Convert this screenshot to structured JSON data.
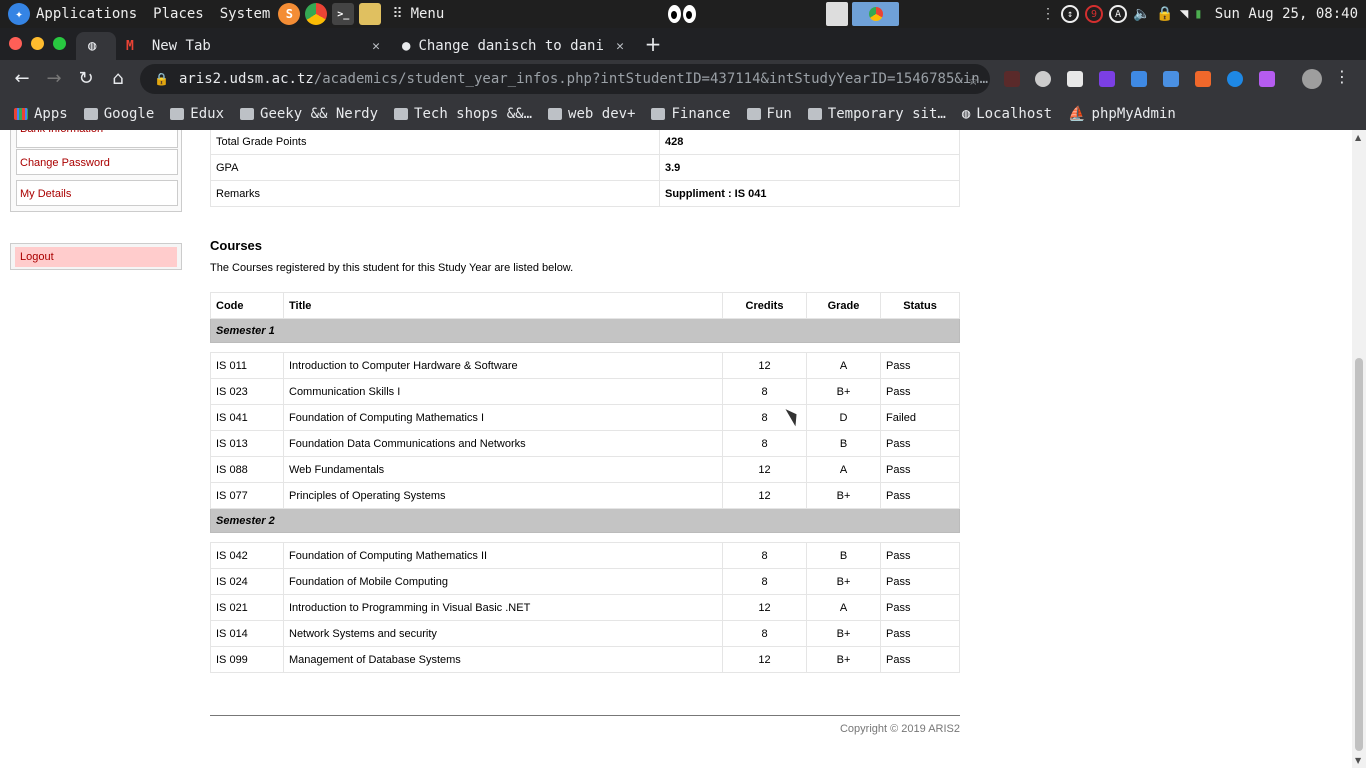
{
  "panel": {
    "menus": [
      "Applications",
      "Places",
      "System"
    ],
    "menu_label": "Menu",
    "launchers": [
      {
        "icon": "sublime-icon",
        "glyph": "S",
        "color": "#f48d35"
      },
      {
        "icon": "chrome-icon",
        "glyph": "",
        "color": "#4caf50"
      },
      {
        "icon": "terminal-icon",
        "glyph": ">_",
        "color": "#444444"
      },
      {
        "icon": "files-icon",
        "glyph": "",
        "color": "#e0c060"
      }
    ],
    "tray": {
      "notification_count": "9",
      "clock": "Sun Aug 25, 08:40"
    }
  },
  "browser": {
    "tabs": [
      {
        "title": "",
        "icon": "globe-icon",
        "active": true
      },
      {
        "title": "New Tab",
        "icon": "gmail-icon",
        "active": false
      },
      {
        "title": "Change danisch to dani",
        "icon": "github-icon",
        "active": false
      }
    ],
    "new_tab_label": "+",
    "url_host": "aris2.udsm.ac.tz",
    "url_path": "/academics/student_year_infos.php?intStudentID=437114&intStudyYearID=1546785&in…",
    "bookmarks": [
      {
        "label": "Apps",
        "icon": "apps-icon"
      },
      {
        "label": "Google",
        "icon": "folder-icon"
      },
      {
        "label": "Edux",
        "icon": "folder-icon"
      },
      {
        "label": "Geeky && Nerdy",
        "icon": "folder-icon"
      },
      {
        "label": "Tech shops &&…",
        "icon": "folder-icon"
      },
      {
        "label": "web dev+",
        "icon": "folder-icon"
      },
      {
        "label": "Finance",
        "icon": "folder-icon"
      },
      {
        "label": "Fun",
        "icon": "folder-icon"
      },
      {
        "label": "Temporary sit…",
        "icon": "folder-icon"
      },
      {
        "label": "Localhost",
        "icon": "globe-icon"
      },
      {
        "label": "phpMyAdmin",
        "icon": "phpmyadmin-icon"
      }
    ]
  },
  "sidebar": {
    "partial_link": "Bank Information",
    "links": [
      "Change Password",
      "My Details"
    ],
    "logout": "Logout"
  },
  "summary": [
    {
      "label": "Total Grade Points",
      "value": "428"
    },
    {
      "label": "GPA",
      "value": "3.9"
    },
    {
      "label": "Remarks",
      "value": "Suppliment : IS 041"
    }
  ],
  "courses": {
    "heading": "Courses",
    "intro": "The Courses registered by this student for this Study Year are listed below.",
    "columns": [
      "Code",
      "Title",
      "Credits",
      "Grade",
      "Status"
    ],
    "semesters": [
      {
        "name": "Semester 1",
        "rows": [
          [
            "IS 011",
            "Introduction to Computer Hardware & Software",
            "12",
            "A",
            "Pass"
          ],
          [
            "IS 023",
            "Communication Skills I",
            "8",
            "B+",
            "Pass"
          ],
          [
            "IS 041",
            "Foundation of Computing Mathematics I",
            "8",
            "D",
            "Failed"
          ],
          [
            "IS 013",
            "Foundation Data Communications and Networks",
            "8",
            "B",
            "Pass"
          ],
          [
            "IS 088",
            "Web Fundamentals",
            "12",
            "A",
            "Pass"
          ],
          [
            "IS 077",
            "Principles of Operating Systems",
            "12",
            "B+",
            "Pass"
          ]
        ]
      },
      {
        "name": "Semester 2",
        "rows": [
          [
            "IS 042",
            "Foundation of Computing Mathematics II",
            "8",
            "B",
            "Pass"
          ],
          [
            "IS 024",
            "Foundation of Mobile Computing",
            "8",
            "B+",
            "Pass"
          ],
          [
            "IS 021",
            "Introduction to Programming in Visual Basic .NET",
            "12",
            "A",
            "Pass"
          ],
          [
            "IS 014",
            "Network Systems and security",
            "8",
            "B+",
            "Pass"
          ],
          [
            "IS 099",
            "Management of Database Systems",
            "12",
            "B+",
            "Pass"
          ]
        ]
      }
    ]
  },
  "footer": "Copyright © 2019 ARIS2"
}
